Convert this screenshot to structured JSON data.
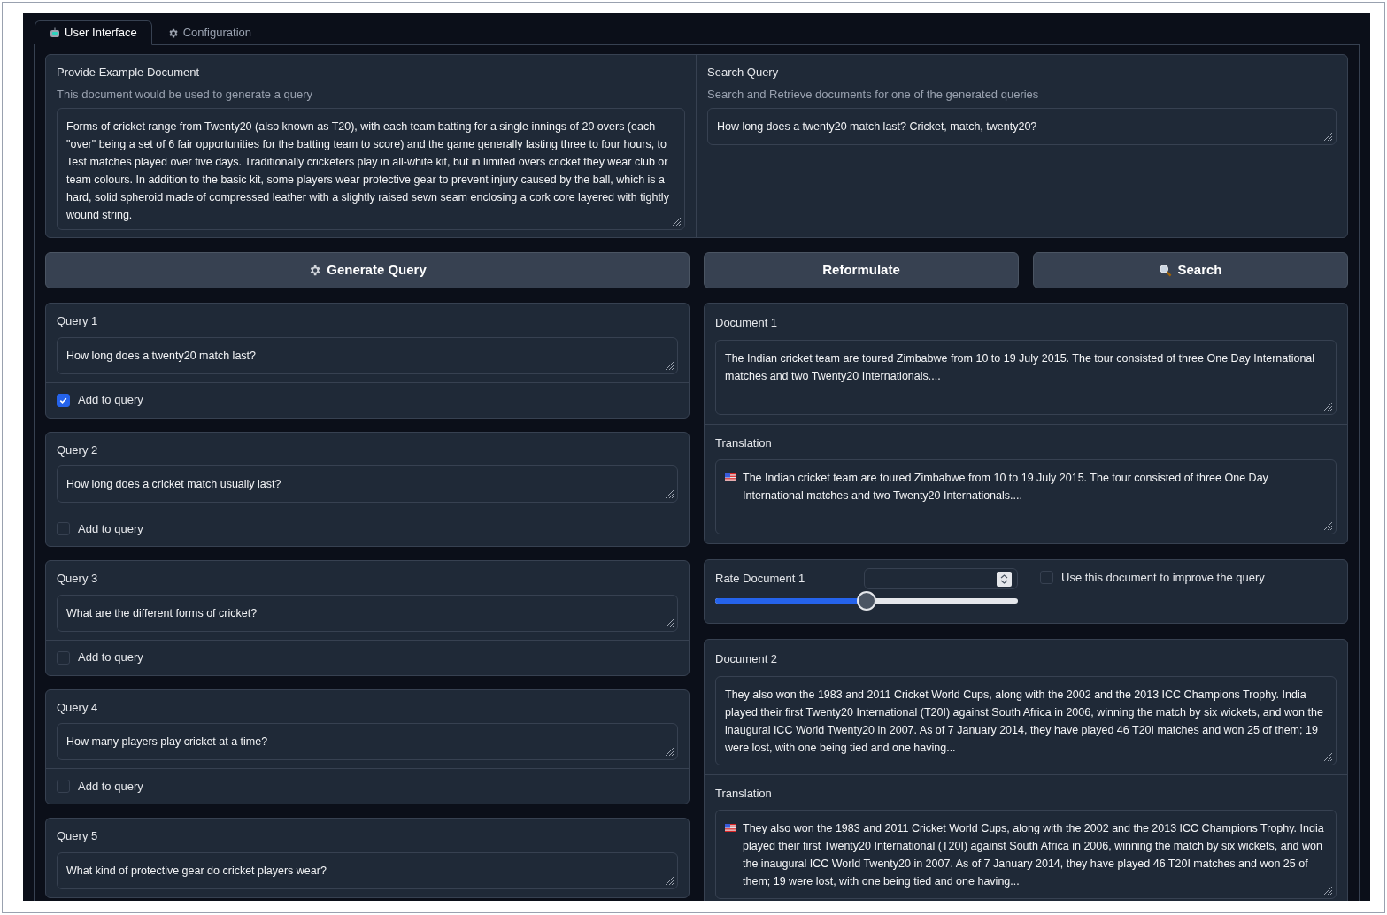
{
  "tabs": [
    {
      "label": "User Interface",
      "selected": true
    },
    {
      "label": "Configuration",
      "selected": false
    }
  ],
  "example_document": {
    "label": "Provide Example Document",
    "info": "This document would be used to generate a query",
    "value": "Forms of cricket range from Twenty20 (also known as T20), with each team batting for a single innings of 20 overs (each \"over\" being a set of 6 fair opportunities for the batting team to score) and the game generally lasting three to four hours, to Test matches played over five days. Traditionally cricketers play in all-white kit, but in limited overs cricket they wear club or team colours. In addition to the basic kit, some players wear protective gear to prevent injury caused by the ball, which is a hard, solid spheroid made of compressed leather with a slightly raised sewn seam enclosing a cork core layered with tightly wound string."
  },
  "search_query": {
    "label": "Search Query",
    "info": "Search and Retrieve documents for one of the generated queries",
    "value": "How long does a twenty20 match last? Cricket, match, twenty20?"
  },
  "buttons": [
    {
      "label": "Generate Query",
      "kind": "gear"
    },
    {
      "label": "Reformulate",
      "kind": "plain"
    },
    {
      "label": "Search",
      "kind": "search"
    }
  ],
  "queries": [
    {
      "label": "Query 1",
      "value": "How long does a twenty20 match last?",
      "checkbox_label": "Add to query",
      "checked": true
    },
    {
      "label": "Query 2",
      "value": "How long does a cricket match usually last?",
      "checkbox_label": "Add to query",
      "checked": false
    },
    {
      "label": "Query 3",
      "value": "What are the different forms of cricket?",
      "checkbox_label": "Add to query",
      "checked": false
    },
    {
      "label": "Query 4",
      "value": "How many players play cricket at a time?",
      "checkbox_label": "Add to query",
      "checked": false
    },
    {
      "label": "Query 5",
      "value": "What kind of protective gear do cricket players wear?"
    }
  ],
  "documents": [
    {
      "label": "Document 1",
      "value": "The Indian cricket team are toured Zimbabwe from 10 to 19 July 2015. The tour consisted of three One Day International matches and two Twenty20 Internationals....",
      "translation_label": "Translation",
      "translation": "The Indian cricket team are toured Zimbabwe from 10 to 19 July 2015. The tour consisted of three One Day International matches and two Twenty20 Internationals....",
      "rating": {
        "label": "Rate Document 1",
        "level": 0.5
      },
      "improve": {
        "label": "Use this document to improve the query",
        "checked": false
      }
    },
    {
      "label": "Document 2",
      "value": "They also won the 1983 and 2011 Cricket World Cups, along with the 2002 and the 2013 ICC Champions Trophy. India played their first Twenty20 International (T20I) against South Africa in 2006, winning the match by six wickets, and won the inaugural ICC World Twenty20 in 2007. As of 7 January 2014, they have played 46 T20I matches and won 25 of them; 19 were lost, with one being tied and one having...",
      "translation_label": "Translation",
      "translation": "They also won the 1983 and 2011 Cricket World Cups, along with the 2002 and the 2013 ICC Champions Trophy. India played their first Twenty20 International (T20I) against South Africa in 2006, winning the match by six wickets, and won the inaugural ICC World Twenty20 in 2007. As of 7 January 2014, they have played 46 T20I matches and won 25 of them; 19 were lost, with one being tied and one having..."
    }
  ]
}
